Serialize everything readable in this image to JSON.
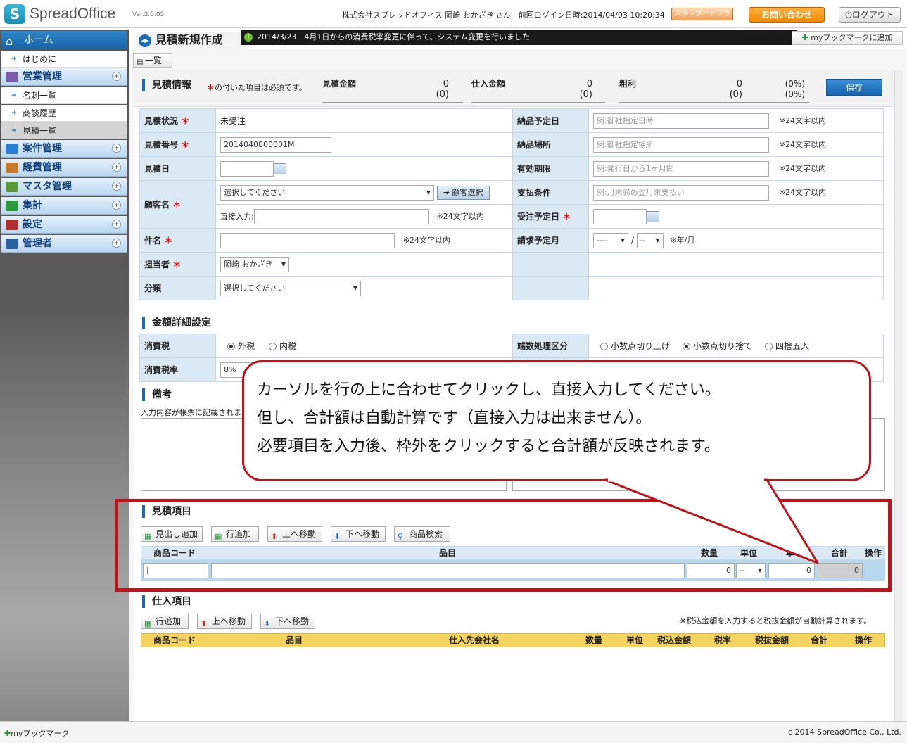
{
  "header": {
    "logo_letter": "S",
    "brand": "SpreadOffice",
    "version": "Ver.3.5.05",
    "company_user": "株式会社スプレッドオフィス 岡崎 おかざき",
    "user_suffix": "さん",
    "last_login": "前回ログイン日時:2014/04/03 10:20:34",
    "plan_label": "スタンダードプラン",
    "contact_label": "お問い合わせ",
    "logout_label": "ログアウト"
  },
  "sidebar": {
    "home": "ホーム",
    "items": [
      {
        "label": "はじめに",
        "type": "sub"
      },
      {
        "label": "営業管理",
        "type": "section",
        "icon_color": "#7b5ea7"
      },
      {
        "label": "名刺一覧",
        "type": "sub"
      },
      {
        "label": "商談履歴",
        "type": "sub"
      },
      {
        "label": "見積一覧",
        "type": "sub",
        "active": true
      },
      {
        "label": "案件管理",
        "type": "section",
        "icon_color": "#2a7fd0"
      },
      {
        "label": "経費管理",
        "type": "section",
        "icon_color": "#c77a2a"
      },
      {
        "label": "マスタ管理",
        "type": "section",
        "icon_color": "#5a9a3a"
      },
      {
        "label": "集計",
        "type": "section",
        "icon_color": "#2a9a3a"
      },
      {
        "label": "設定",
        "type": "section",
        "icon_color": "#b03030"
      },
      {
        "label": "管理者",
        "type": "section",
        "icon_color": "#2a5fa0"
      }
    ],
    "plus_symbol": "+"
  },
  "page": {
    "title": "見積新規作成",
    "notice_mark": "!",
    "notice": "2014/3/23　4月1日からの消費税率変更に伴って、システム変更を行いました",
    "bookmark_add": "myブックマークに追加",
    "list_button": "一覧"
  },
  "summary": {
    "section_title": "見積情報",
    "required_note_mark": "＊",
    "required_note": "の付いた項目は必須です。",
    "estimate_label": "見積金額",
    "estimate_value": "0",
    "estimate_sub": "(0)",
    "purchase_label": "仕入金額",
    "purchase_value": "0",
    "purchase_sub": "(0)",
    "profit_label": "粗利",
    "profit_value": "0",
    "profit_sub": "(0)",
    "profit_pct": "(0%)",
    "profit_pct_sub": "(0%)",
    "save_label": "保存"
  },
  "form": {
    "status_label": "見積状況",
    "status_value": "未受注",
    "number_label": "見積番号",
    "number_value": "2014040800001M",
    "date_label": "見積日",
    "customer_label": "顧客名",
    "customer_select": "選択してください",
    "customer_pick": "顧客選択",
    "direct_label": "直接入力:",
    "direct_note": "※24文字以内",
    "subject_label": "件名",
    "subject_note": "※24文字以内",
    "staff_label": "担当者",
    "staff_value": "岡崎 おかざき",
    "category_label": "分類",
    "category_value": "選択してください",
    "delivery_date_label": "納品予定日",
    "delivery_date_ph": "例:御社指定日時",
    "delivery_date_note": "※24文字以内",
    "delivery_place_label": "納品場所",
    "delivery_place_ph": "例:御社指定場所",
    "delivery_place_note": "※24文字以内",
    "valid_label": "有効期限",
    "valid_ph": "例:発行日から1ヶ月間",
    "valid_note": "※24文字以内",
    "payment_label": "支払条件",
    "payment_ph": "例:月末締め翌月末支払い",
    "payment_note": "※24文字以内",
    "order_date_label": "受注予定日",
    "bill_month_label": "請求予定月",
    "bill_year": "----",
    "bill_sep": "/",
    "bill_month": "--",
    "bill_note": "※年/月",
    "required_mark": "＊"
  },
  "amount": {
    "section_title": "金額詳細設定",
    "tax_label": "消費税",
    "tax_outer": "外税",
    "tax_inner": "内税",
    "round_label": "端数処理区分",
    "round_up": "小数点切り上げ",
    "round_down": "小数点切り捨て",
    "round_half": "四捨五入",
    "rate_label": "消費税率",
    "rate_value": "8%"
  },
  "remarks": {
    "section_title": "備考",
    "note": "入力内容が帳票に記載されます"
  },
  "items": {
    "section_title": "見積項目",
    "buttons": [
      "見出し追加",
      "行追加",
      "上へ移動",
      "下へ移動",
      "商品検索"
    ],
    "columns": [
      "商品コード",
      "品目",
      "数量",
      "単位",
      "単",
      "合計",
      "操作"
    ],
    "qty": "0",
    "unit": "--",
    "price": "0",
    "total": "0"
  },
  "purchase": {
    "section_title": "仕入項目",
    "buttons": [
      "行追加",
      "上へ移動",
      "下へ移動"
    ],
    "note": "※税込金額を入力すると税抜金額が自動計算されます。",
    "columns": [
      "商品コード",
      "品目",
      "仕入先会社名",
      "数量",
      "単位",
      "税込金額",
      "税率",
      "税抜金額",
      "合計",
      "操作"
    ]
  },
  "callout": {
    "line1": "カーソルを行の上に合わせてクリックし、直接入力してください。",
    "line2": "但し、合計額は自動計算です（直接入力は出来ません）。",
    "line3": "必要項目を入力後、枠外をクリックすると合計額が反映されます。"
  },
  "footer": {
    "mybookmark": "myブックマーク",
    "copyright": "c 2014 SpreadOffice Co., Ltd."
  },
  "colors": {
    "accent": "#1a6ab8",
    "callout_border": "#c0121a",
    "purchase_header": "#f4d35e"
  }
}
